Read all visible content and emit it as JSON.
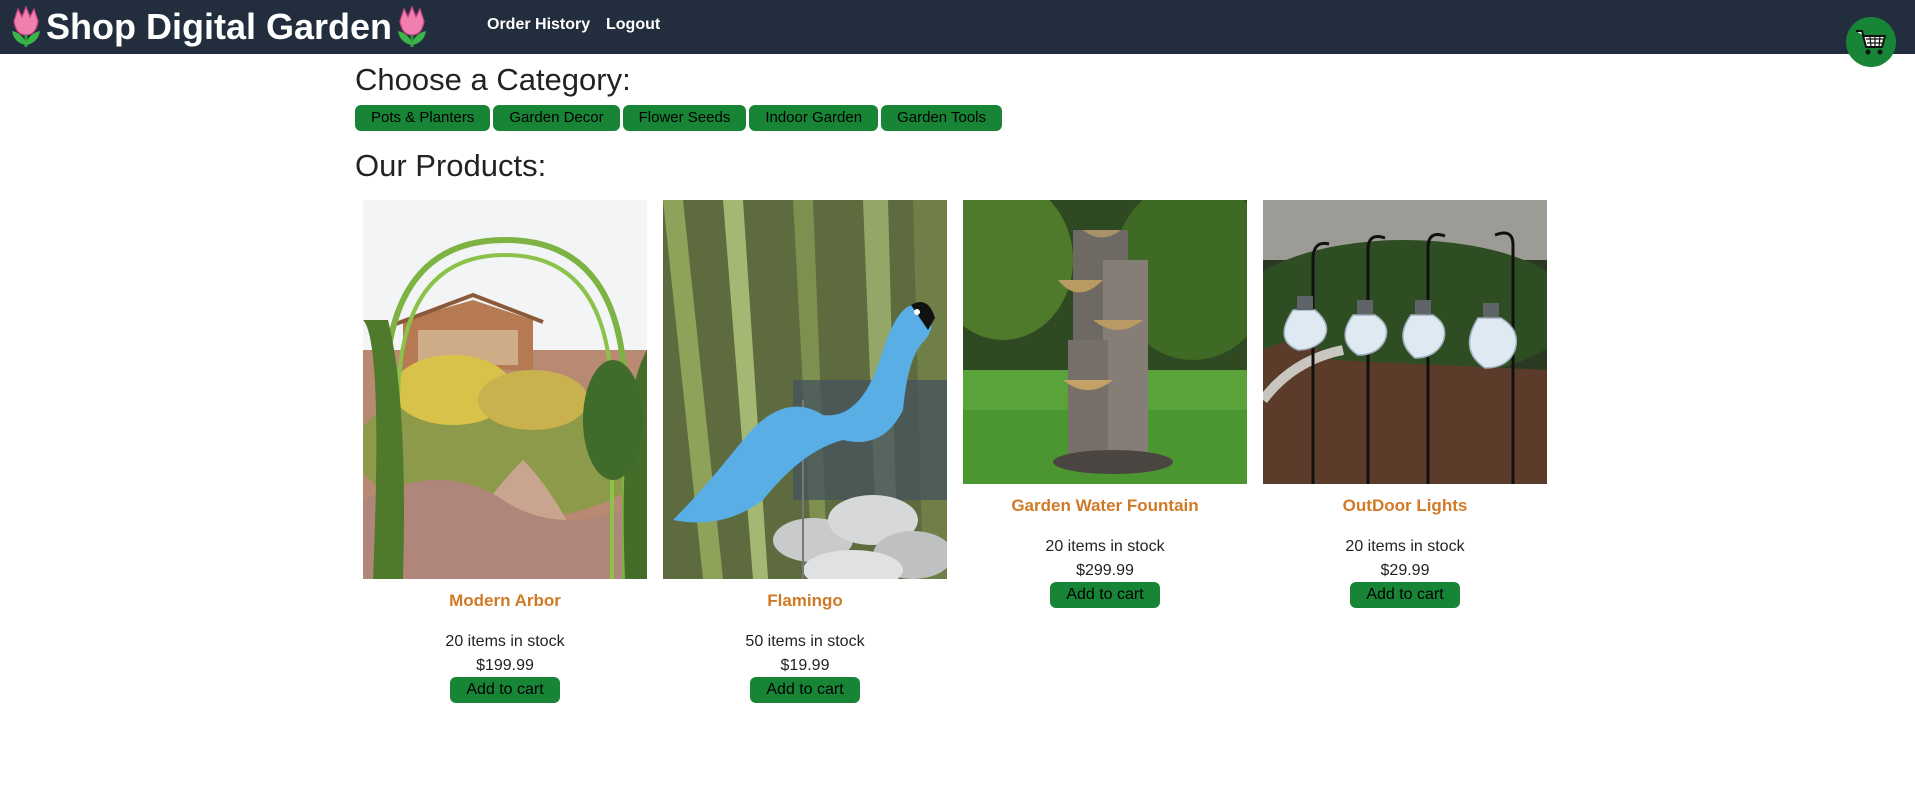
{
  "header": {
    "brand": "Shop Digital Garden",
    "brand_icon": "tulip-icon",
    "nav": [
      "Order History",
      "Logout"
    ],
    "cart_icon": "shopping-cart-icon",
    "bg_color": "#222d3d"
  },
  "categories": {
    "heading": "Choose a Category:",
    "items": [
      "Pots & Planters",
      "Garden Decor",
      "Flower Seeds",
      "Indoor Garden",
      "Garden Tools"
    ]
  },
  "products": {
    "heading": "Our Products:",
    "add_label": "Add to cart",
    "items": [
      {
        "name": "Modern Arbor",
        "stock": "20 items in stock",
        "price": "$199.99"
      },
      {
        "name": "Flamingo",
        "stock": "50 items in stock",
        "price": "$19.99"
      },
      {
        "name": "Garden Water Fountain",
        "stock": "20 items in stock",
        "price": "$299.99"
      },
      {
        "name": "OutDoor Lights",
        "stock": "20 items in stock",
        "price": "$29.99"
      }
    ]
  },
  "colors": {
    "accent_green": "#188436",
    "product_name": "#d17a26"
  }
}
